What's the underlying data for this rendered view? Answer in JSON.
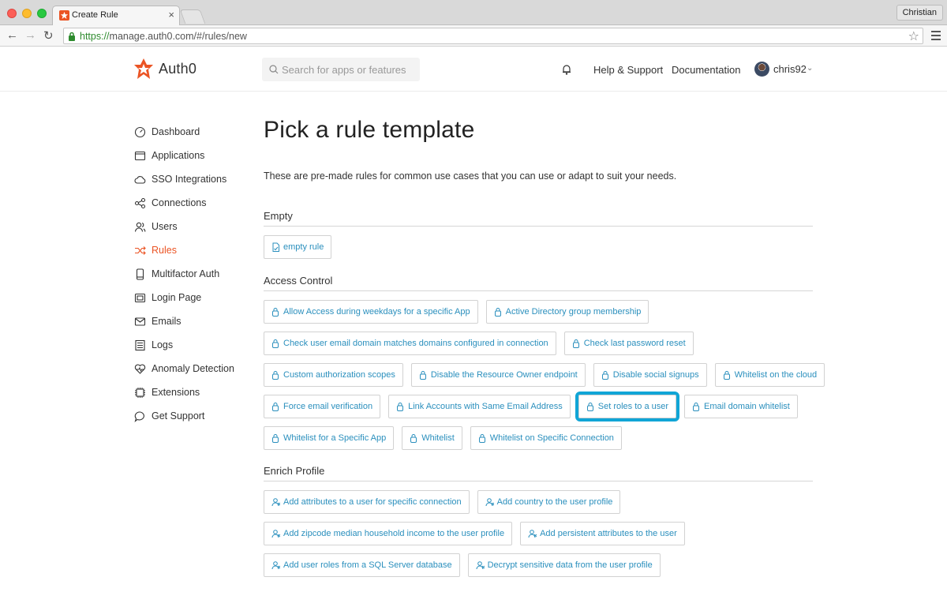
{
  "browser": {
    "tab_title": "Create Rule",
    "tab_close": "×",
    "profile": "Christian",
    "url_scheme": "https://",
    "url_rest": "manage.auth0.com/#/rules/new",
    "back": "←",
    "forward": "→",
    "reload": "↻",
    "star": "☆"
  },
  "header": {
    "logo_text": "Auth0",
    "search_placeholder": "Search for apps or features",
    "help_support": "Help & Support",
    "documentation": "Documentation",
    "username": "chris92",
    "caret": "⌄"
  },
  "sidebar": {
    "items": [
      {
        "label": "Dashboard",
        "icon": "dashboard-icon"
      },
      {
        "label": "Applications",
        "icon": "applications-icon"
      },
      {
        "label": "SSO Integrations",
        "icon": "cloud-icon"
      },
      {
        "label": "Connections",
        "icon": "connections-icon"
      },
      {
        "label": "Users",
        "icon": "users-icon"
      },
      {
        "label": "Rules",
        "icon": "rules-icon",
        "active": true
      },
      {
        "label": "Multifactor Auth",
        "icon": "phone-icon"
      },
      {
        "label": "Login Page",
        "icon": "login-page-icon"
      },
      {
        "label": "Emails",
        "icon": "mail-icon"
      },
      {
        "label": "Logs",
        "icon": "logs-icon"
      },
      {
        "label": "Anomaly Detection",
        "icon": "heart-icon"
      },
      {
        "label": "Extensions",
        "icon": "chip-icon"
      },
      {
        "label": "Get Support",
        "icon": "chat-icon"
      }
    ]
  },
  "main": {
    "title": "Pick a rule template",
    "subtitle": "These are pre-made rules for common use cases that you can use or adapt to suit your needs.",
    "sections": {
      "empty": {
        "heading": "Empty",
        "rows": [
          [
            "empty rule"
          ]
        ]
      },
      "access": {
        "heading": "Access Control",
        "rows": [
          [
            "Allow Access during weekdays for a specific App",
            "Active Directory group membership"
          ],
          [
            "Check user email domain matches domains configured in connection",
            "Check last password reset"
          ],
          [
            "Custom authorization scopes",
            "Disable the Resource Owner endpoint",
            "Disable social signups",
            "Whitelist on the cloud"
          ],
          [
            "Force email verification",
            "Link Accounts with Same Email Address",
            "Set roles to a user",
            "Email domain whitelist"
          ],
          [
            "Whitelist for a Specific App",
            "Whitelist",
            "Whitelist on Specific Connection"
          ]
        ]
      },
      "enrich": {
        "heading": "Enrich Profile",
        "rows": [
          [
            "Add attributes to a user for specific connection",
            "Add country to the user profile"
          ],
          [
            "Add zipcode median household income to the user profile",
            "Add persistent attributes to the user"
          ],
          [
            "Add user roles from a SQL Server database",
            "Decrypt sensitive data from the user profile"
          ]
        ]
      }
    },
    "highlighted": "Set roles to a user"
  },
  "colors": {
    "accent": "#eb5424",
    "link": "#2a8fbd",
    "highlight": "#11a5d6"
  }
}
